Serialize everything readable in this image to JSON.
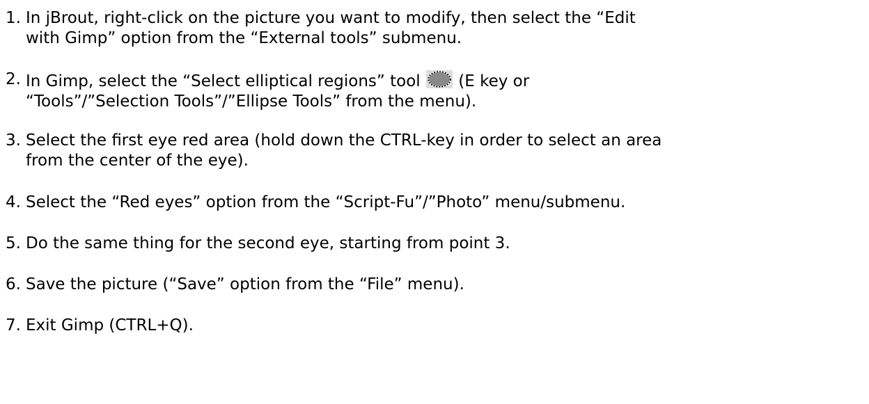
{
  "steps": [
    {
      "number": "1.",
      "lines": [
        "In jBrout, right-click on the picture you want to modify, then select the “Edit",
        "with Gimp” option from the “External tools” submenu."
      ]
    },
    {
      "number": "2.",
      "line1_before_icon": "In Gimp, select the “Select elliptical regions” tool",
      "line1_after_icon": " (E key or",
      "line2": "“Tools”/”Selection Tools”/”Ellipse Tools” from the menu).",
      "icon": "ellipse-select-tool-icon"
    },
    {
      "number": "3.",
      "lines": [
        "Select the first eye red area (hold down the CTRL-key in order to select an area",
        "from the center of the eye)."
      ]
    },
    {
      "number": "4.",
      "lines": [
        "Select the “Red eyes” option from the “Script-Fu”/”Photo” menu/submenu."
      ]
    },
    {
      "number": "5.",
      "lines": [
        "Do the same thing for the second eye, starting from point 3."
      ]
    },
    {
      "number": "6.",
      "lines": [
        "Save the picture (“Save” option from the “File” menu)."
      ]
    },
    {
      "number": "7.",
      "lines": [
        "Exit Gimp (CTRL+Q)."
      ]
    }
  ]
}
